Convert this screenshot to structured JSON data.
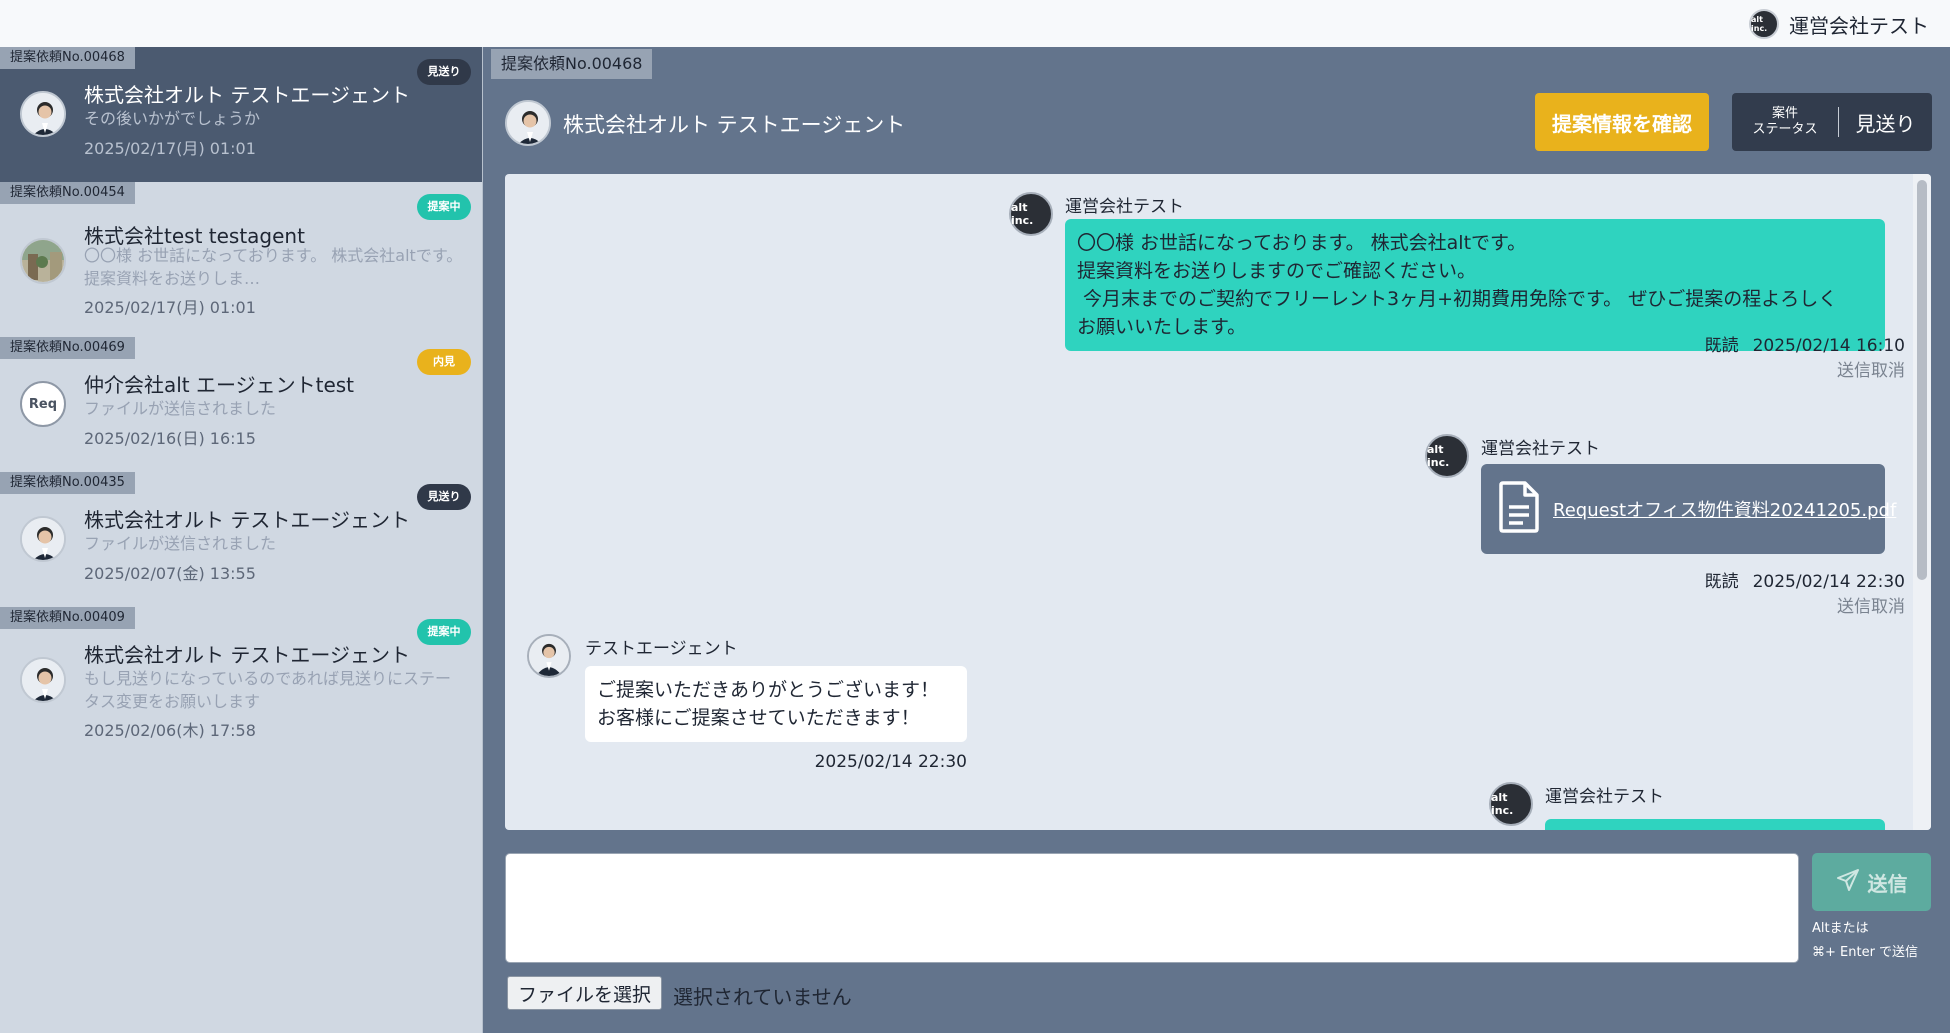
{
  "header": {
    "user_name": "運営会社テスト",
    "logo_text": "alt inc."
  },
  "sidebar": {
    "items": [
      {
        "req_no": "提案依頼No.00468",
        "status": "見送り",
        "company": "株式会社オルト テストエージェント",
        "preview": "その後いかがでしょうか",
        "timestamp": "2025/02/17(月) 01:01"
      },
      {
        "req_no": "提案依頼No.00454",
        "status": "提案中",
        "company": "株式会社test testagent",
        "preview": "〇〇様 お世話になっております。 株式会社altです。 提案資料をお送りしま…",
        "timestamp": "2025/02/17(月) 01:01"
      },
      {
        "req_no": "提案依頼No.00469",
        "status": "内見",
        "company": "仲介会社alt エージェントtest",
        "preview": "ファイルが送信されました",
        "timestamp": "2025/02/16(日) 16:15",
        "avatar_text": "Req"
      },
      {
        "req_no": "提案依頼No.00435",
        "status": "見送り",
        "company": "株式会社オルト テストエージェント",
        "preview": "ファイルが送信されました",
        "timestamp": "2025/02/07(金) 13:55"
      },
      {
        "req_no": "提案依頼No.00409",
        "status": "提案中",
        "company": "株式会社オルト テストエージェント",
        "preview": "もし見送りになっているのであれば見送りにステータス変更をお願いします",
        "timestamp": "2025/02/06(木) 17:58"
      }
    ]
  },
  "main": {
    "req_no": "提案依頼No.00468",
    "title": "株式会社オルト テストエージェント",
    "info_button": "提案情報を確認",
    "status_label_line1": "案件",
    "status_label_line2": "ステータス",
    "status_value": "見送り"
  },
  "chat": {
    "messages": [
      {
        "sender": "運営会社テスト",
        "lines": [
          "〇〇様 お世話になっております。 株式会社altです。",
          "提案資料をお送りしますのでご確認ください。",
          " 今月末までのご契約でフリーレント3ヶ月+初期費用免除です。 ぜひご提案の程よろしく",
          "お願いいたします。"
        ],
        "read": "既読",
        "timestamp": "2025/02/14 16:10",
        "cancel": "送信取消"
      },
      {
        "sender": "運営会社テスト",
        "file_name": "Requestオフィス物件資料20241205.pdf",
        "read": "既読",
        "timestamp": "2025/02/14 22:30",
        "cancel": "送信取消"
      },
      {
        "sender": "テストエージェント",
        "lines": [
          "ご提案いただきありがとうございます！",
          "お客様にご提案させていただきます！"
        ],
        "timestamp": "2025/02/14 22:30"
      },
      {
        "sender": "運営会社テスト"
      }
    ]
  },
  "composer": {
    "placeholder": "",
    "send_label": "送信",
    "hint_line1": "Altまたは",
    "hint_line2": "⌘+ Enter で送信",
    "file_button": "ファイルを選択",
    "file_none": "選択されていません"
  },
  "colors": {
    "accent_yellow": "#e9b21c",
    "accent_teal": "#2fd3bf",
    "status_proposing": "#22c3ac",
    "status_skip": "#303949",
    "main_bg": "#63748c"
  }
}
